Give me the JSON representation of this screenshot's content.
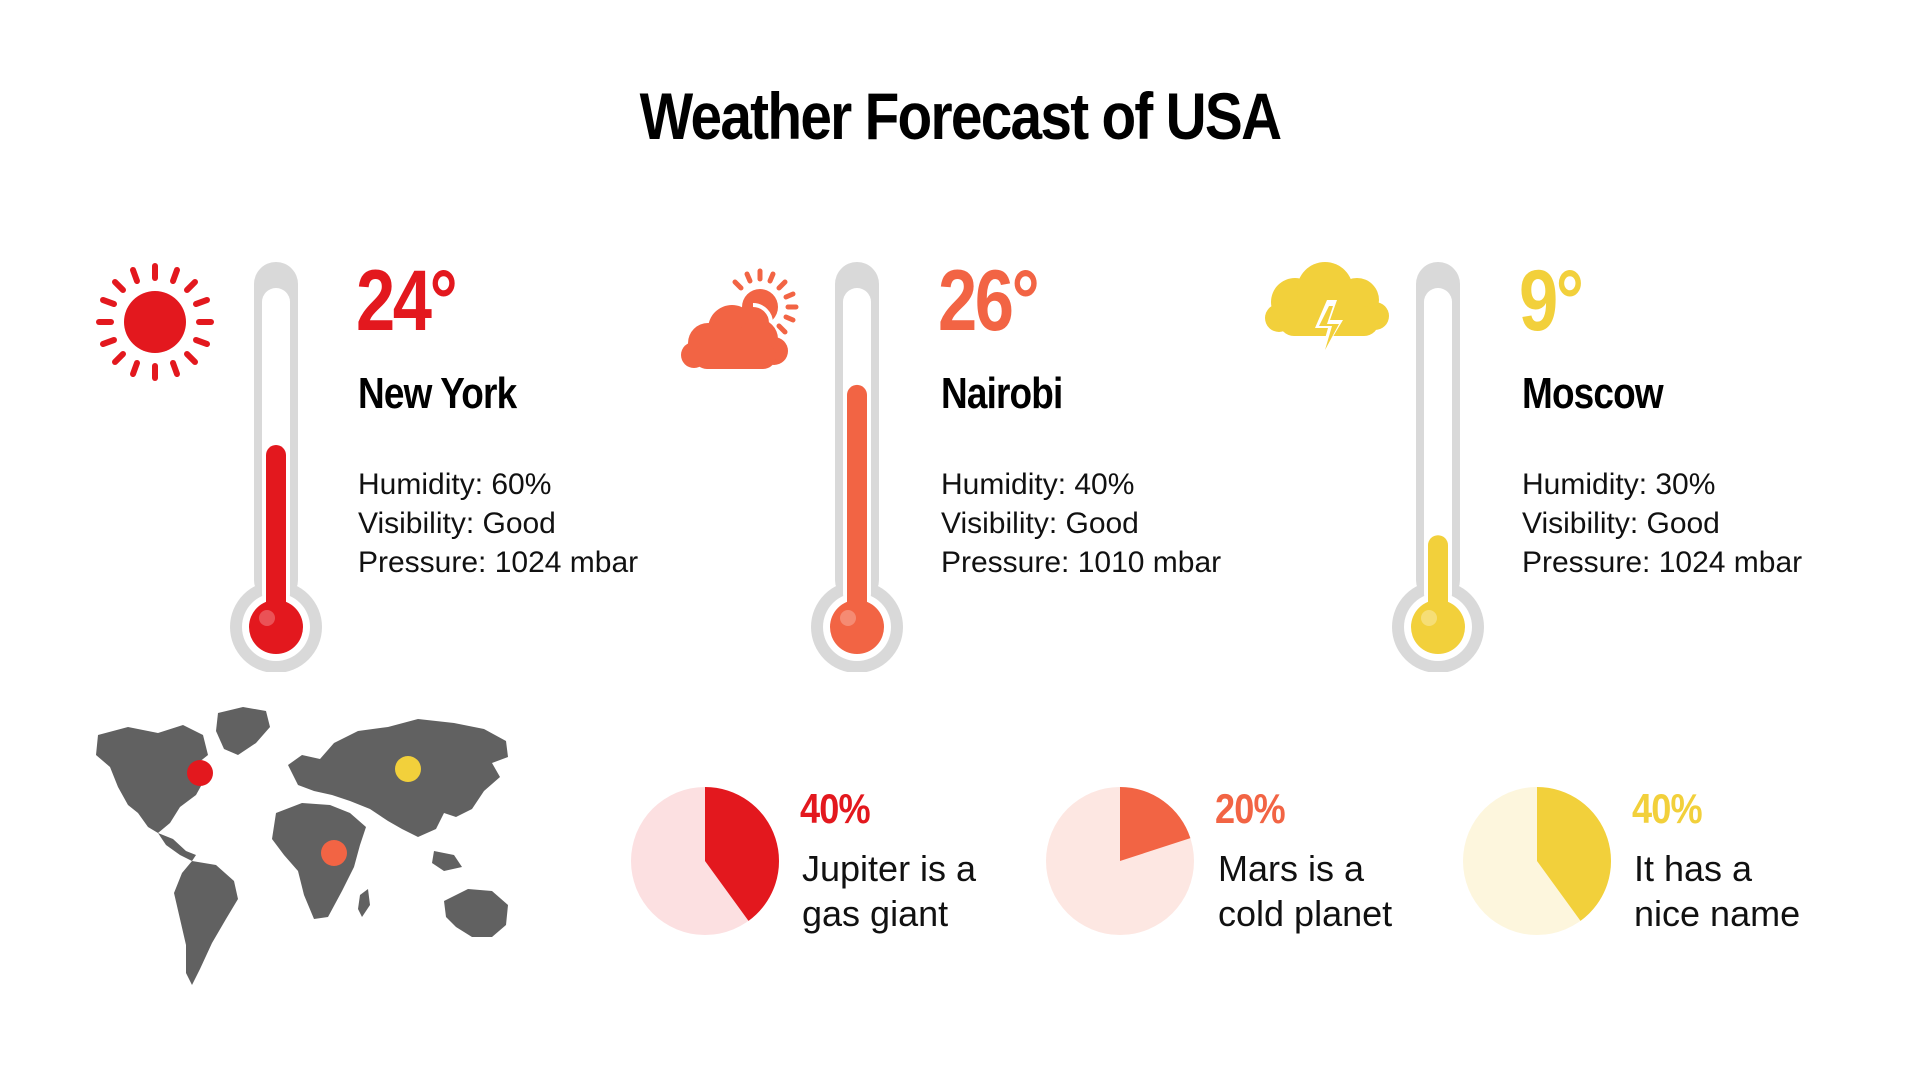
{
  "title": "Weather Forecast of USA",
  "colors": {
    "red": "#E3181E",
    "orange": "#F26444",
    "yellow": "#F2D03B",
    "gray": "#D9D9D9",
    "map": "#616161"
  },
  "cities": [
    {
      "temperature": "24°",
      "name": "New York",
      "humidity": "Humidity: 60%",
      "visibility": "Visibility: Good",
      "pressure": "Pressure: 1024 mbar",
      "icon": "sun-icon",
      "level": 0.44
    },
    {
      "temperature": "26°",
      "name": "Nairobi",
      "humidity": "Humidity: 40%",
      "visibility": "Visibility: Good",
      "pressure": "Pressure: 1010 mbar",
      "icon": "sun-behind-cloud-icon",
      "level": 0.62
    },
    {
      "temperature": "9°",
      "name": "Moscow",
      "humidity": "Humidity: 30%",
      "visibility": "Visibility: Good",
      "pressure": "Pressure: 1024 mbar",
      "icon": "thunderstorm-cloud-icon",
      "level": 0.17
    }
  ],
  "map_icon": "world-map-icon",
  "stats": [
    {
      "percent": "40%",
      "line1": "Jupiter is a",
      "line2": "gas giant",
      "value": 40
    },
    {
      "percent": "20%",
      "line1": "Mars is a",
      "line2": "cold planet",
      "value": 20
    },
    {
      "percent": "40%",
      "line1": "It has a",
      "line2": "nice name",
      "value": 40
    }
  ]
}
